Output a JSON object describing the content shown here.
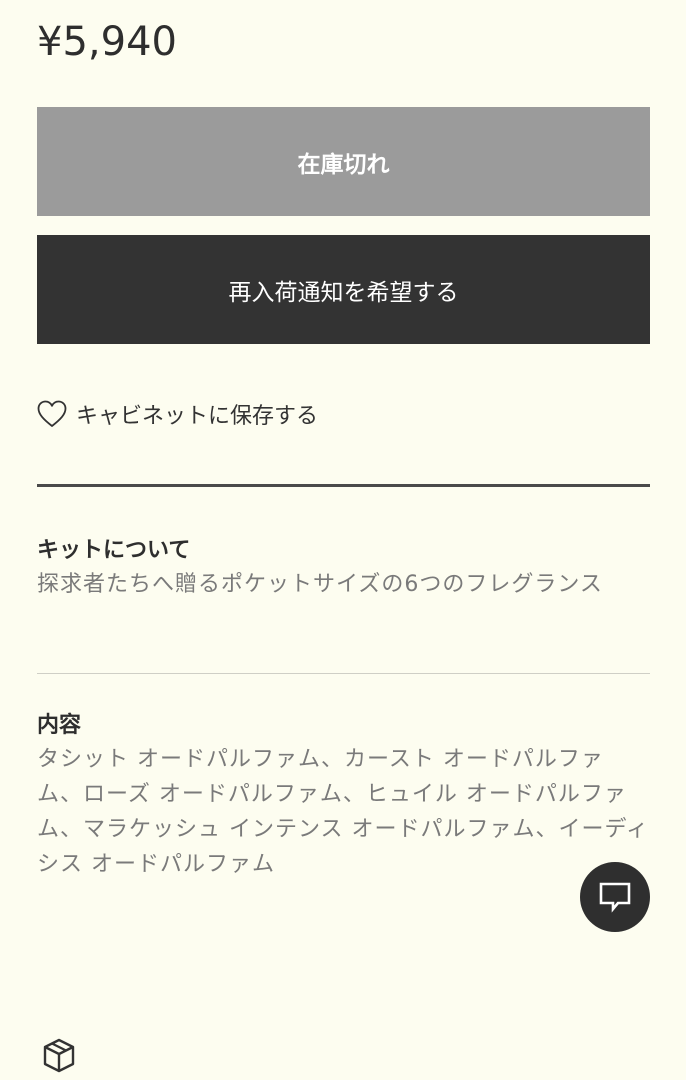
{
  "product": {
    "price": "¥5,940"
  },
  "buttons": {
    "sold_out_label": "在庫切れ",
    "notify_label": "再入荷通知を希望する"
  },
  "cabinet": {
    "save_label": "キャビネットに保存する",
    "icon": "heart-outline-icon"
  },
  "kit": {
    "heading": "キットについて",
    "description": "探求者たちへ贈るポケットサイズの6つのフレグランス"
  },
  "contents": {
    "heading": "内容",
    "description": "タシット オードパルファム、カースト オードパルファム、ローズ オードパルファム、ヒュイル オードパルファム、マラケッシュ インテンス オードパルファム、イーディシス オードパルファム"
  },
  "floating": {
    "chat_icon": "chat-bubble-icon",
    "box_icon": "package-box-icon"
  },
  "colors": {
    "background": "#fdfdf0",
    "sold_out_bg": "#9b9b9b",
    "primary_bg": "#333333",
    "muted_text": "#7a7a7a"
  }
}
